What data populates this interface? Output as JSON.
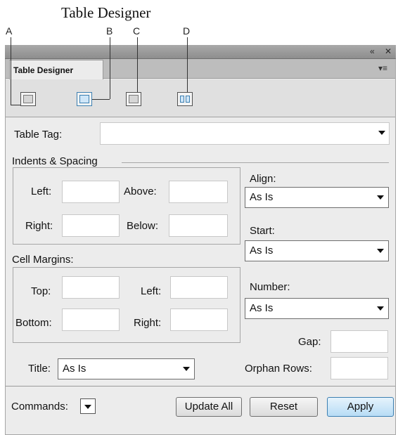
{
  "figure": {
    "title": "Table Designer",
    "callouts": [
      "A",
      "B",
      "C",
      "D"
    ]
  },
  "panel": {
    "collapse_icon": "double-left-arrow-icon",
    "close_icon": "close-icon",
    "tab_label": "Table Designer",
    "menu_icon": "panel-menu-icon",
    "toolbar_icons": [
      "basic-properties-icon",
      "ruling-properties-icon",
      "shading-properties-icon",
      "row-format-icon"
    ]
  },
  "form": {
    "table_tag_label": "Table Tag:",
    "table_tag_value": "",
    "indents_label": "Indents & Spacing",
    "left_label": "Left:",
    "left_value": "",
    "above_label": "Above:",
    "above_value": "",
    "right_label": "Right:",
    "right_value": "",
    "below_label": "Below:",
    "below_value": "",
    "align_label": "Align:",
    "align_value": "As Is",
    "start_label": "Start:",
    "start_value": "As Is",
    "cell_margins_label": "Cell Margins:",
    "top_label": "Top:",
    "top_value": "",
    "cm_left_label": "Left:",
    "cm_left_value": "",
    "bottom_label": "Bottom:",
    "bottom_value": "",
    "cm_right_label": "Right:",
    "cm_right_value": "",
    "number_label": "Number:",
    "number_value": "As Is",
    "gap_label": "Gap:",
    "gap_value": "",
    "title_label": "Title:",
    "title_value": "As Is",
    "orphan_label": "Orphan Rows:",
    "orphan_value": ""
  },
  "footer": {
    "commands_label": "Commands:",
    "update_all": "Update All",
    "reset": "Reset",
    "apply": "Apply"
  }
}
